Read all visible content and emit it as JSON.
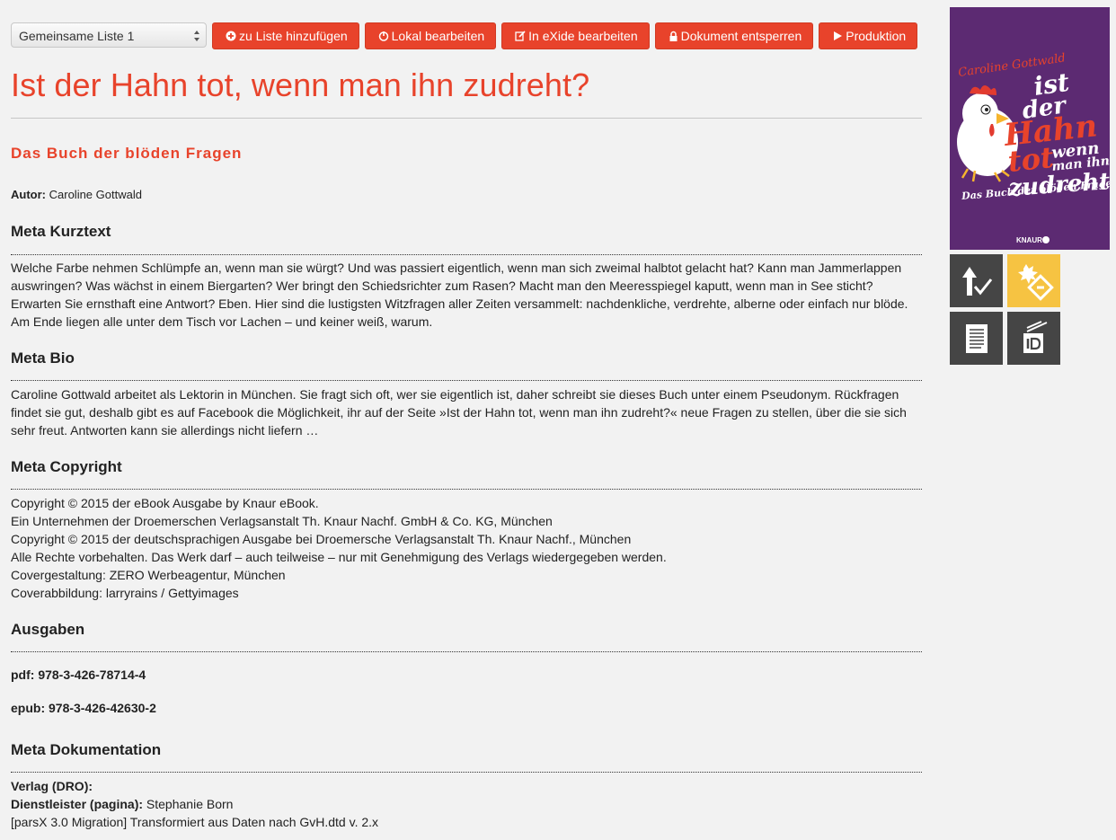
{
  "toolbar": {
    "list_select": "Gemeinsame Liste 1",
    "buttons": [
      {
        "label": "zu Liste hinzufügen",
        "icon": "plus-circle-icon"
      },
      {
        "label": "Lokal bearbeiten",
        "icon": "power-icon"
      },
      {
        "label": "In eXide bearbeiten",
        "icon": "edit-icon"
      },
      {
        "label": "Dokument entsperren",
        "icon": "lock-icon"
      },
      {
        "label": "Produktion",
        "icon": "play-icon"
      }
    ]
  },
  "book": {
    "title": "Ist der Hahn tot, wenn man ihn zudreht?",
    "subtitle": "Das Buch der blöden Fragen",
    "author_label": "Autor:",
    "author": "Caroline Gottwald"
  },
  "sections": {
    "kurztext": {
      "heading": "Meta Kurztext",
      "lines": [
        "Welche Farbe nehmen Schlümpfe an, wenn man sie würgt? Und was passiert eigentlich, wenn man sich zweimal halbtot gelacht hat? Kann man Jammerlappen",
        "auswringen? Was wächst in einem Biergarten? Wer bringt den Schiedsrichter zum Rasen? Macht man den Meeresspiegel kaputt, wenn man in See sticht?",
        "Erwarten Sie ernsthaft eine Antwort? Eben. Hier sind die lustigsten Witzfragen aller Zeiten versammelt: nachdenkliche, verdrehte, alberne oder einfach nur blöde.",
        "Am Ende liegen alle unter dem Tisch vor Lachen – und keiner weiß, warum."
      ]
    },
    "bio": {
      "heading": "Meta Bio",
      "lines": [
        "Caroline Gottwald arbeitet als Lektorin in München. Sie fragt sich oft, wer sie eigentlich ist, daher schreibt sie dieses Buch unter einem Pseudonym. Rückfragen",
        "findet sie gut, deshalb gibt es auf Facebook die Möglichkeit, ihr auf der Seite »Ist der Hahn tot, wenn man ihn zudreht?« neue Fragen zu stellen, über die sie sich",
        "sehr freut. Antworten kann sie allerdings nicht liefern …"
      ]
    },
    "copyright": {
      "heading": "Meta Copyright",
      "lines": [
        "Copyright © 2015 der eBook Ausgabe by Knaur eBook.",
        "Ein Unternehmen der Droemerschen Verlagsanstalt Th. Knaur Nachf. GmbH & Co. KG, München",
        "Copyright © 2015 der deutschsprachigen Ausgabe bei Droemersche Verlagsanstalt Th. Knaur Nachf., München",
        "Alle Rechte vorbehalten. Das Werk darf – auch teilweise – nur mit Genehmigung des Verlags wiedergegeben werden.",
        "Covergestaltung: ZERO Werbeagentur, München",
        "Coverabbildung: larryrains / Gettyimages"
      ]
    },
    "ausgaben": {
      "heading": "Ausgaben",
      "pdf": "pdf: 978-3-426-78714-4",
      "epub": "epub: 978-3-426-42630-2"
    },
    "dokumentation": {
      "heading": "Meta Dokumentation",
      "verlag_label": "Verlag (DRO):",
      "dienst_label": "Dienstleister (pagina):",
      "dienst_value": "Stephanie Born",
      "note": "[parsX 3.0 Migration] Transformiert aus Daten nach GvH.dtd v. 2.x"
    }
  },
  "cover": {
    "author": "Caroline Gottwald",
    "title_words": [
      "ist",
      "der",
      "Hahn",
      "tot",
      "wenn",
      "man ihn",
      "zudreht?"
    ],
    "subtitle": "Das Buch der blöden Fragen",
    "publisher": "KNAUR",
    "background": "#5c2a72"
  },
  "tiles": [
    {
      "icon": "upload-check-icon"
    },
    {
      "icon": "epub-badge-icon"
    },
    {
      "icon": "document-icon"
    },
    {
      "icon": "indesign-icon"
    }
  ],
  "colors": {
    "accent": "#e8432b",
    "background": "#f2f2f2",
    "tile_dark": "#454545",
    "tile_yellow": "#f6c342"
  }
}
